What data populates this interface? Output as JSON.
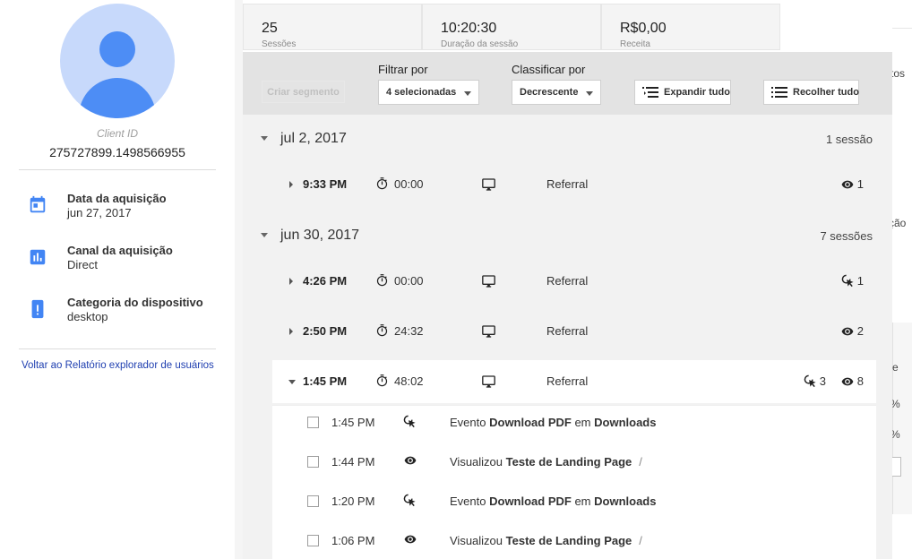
{
  "profile": {
    "client_id_label": "Client ID",
    "client_id": "275727899.1498566955",
    "items": [
      {
        "icon": "calendar-icon",
        "title": "Data da aquisição",
        "value": "jun 27, 2017"
      },
      {
        "icon": "bar-chart-icon",
        "title": "Canal da aquisição",
        "value": "Direct"
      },
      {
        "icon": "mobile-device-icon",
        "title": "Categoria do dispositivo",
        "value": "desktop"
      }
    ],
    "back_link": "Voltar ao Relatório explorador de usuários"
  },
  "metrics": [
    {
      "value": "25",
      "label": "Sessões"
    },
    {
      "value": "10:20:30",
      "label": "Duração da sessão"
    },
    {
      "value": "R$0,00",
      "label": "Receita"
    }
  ],
  "toolbar": {
    "create_segment": "Criar segmento",
    "filter_label": "Filtrar por",
    "filter_value": "4 selecionadas",
    "sort_label": "Classificar por",
    "sort_value": "Decrescente",
    "expand_all": "Expandir tudo",
    "collapse_all": "Recolher tudo"
  },
  "date_groups": [
    {
      "date": "jul 2, 2017",
      "count": "1 sessão",
      "sessions": [
        {
          "time": "9:33 PM",
          "duration": "00:00",
          "device": "desktop-icon",
          "source": "Referral",
          "events": null,
          "pageviews": "1",
          "open": false
        }
      ]
    },
    {
      "date": "jun 30, 2017",
      "count": "7 sessões",
      "sessions": [
        {
          "time": "4:26 PM",
          "duration": "00:00",
          "device": "desktop-icon",
          "source": "Referral",
          "events": "1",
          "pageviews": null,
          "open": false
        },
        {
          "time": "2:50 PM",
          "duration": "24:32",
          "device": "desktop-icon",
          "source": "Referral",
          "events": null,
          "pageviews": "2",
          "open": false
        },
        {
          "time": "1:45 PM",
          "duration": "48:02",
          "device": "desktop-icon",
          "source": "Referral",
          "events": "3",
          "pageviews": "8",
          "open": true
        }
      ]
    }
  ],
  "hits": [
    {
      "time": "1:45 PM",
      "type": "event",
      "prefix": "Evento",
      "name": "Download PDF",
      "mid": "em",
      "category": "Downloads",
      "suffix": ""
    },
    {
      "time": "1:44 PM",
      "type": "pageview",
      "prefix": "Visualizou",
      "name": "Teste de Landing Page",
      "mid": "",
      "category": "",
      "suffix": "/"
    },
    {
      "time": "1:20 PM",
      "type": "event",
      "prefix": "Evento",
      "name": "Download PDF",
      "mid": "em",
      "category": "Downloads",
      "suffix": ""
    },
    {
      "time": "1:06 PM",
      "type": "pageview",
      "prefix": "Visualizou",
      "name": "Teste de Landing Page",
      "mid": "",
      "category": "",
      "suffix": "/"
    }
  ],
  "right_fragments": [
    "tos",
    "ção",
    "e",
    "%",
    "%"
  ],
  "colors": {
    "accent": "#4285f4",
    "avatar_bg": "#c7d9fb",
    "avatar_fg": "#4d8df5",
    "link": "#1f3fb0"
  }
}
